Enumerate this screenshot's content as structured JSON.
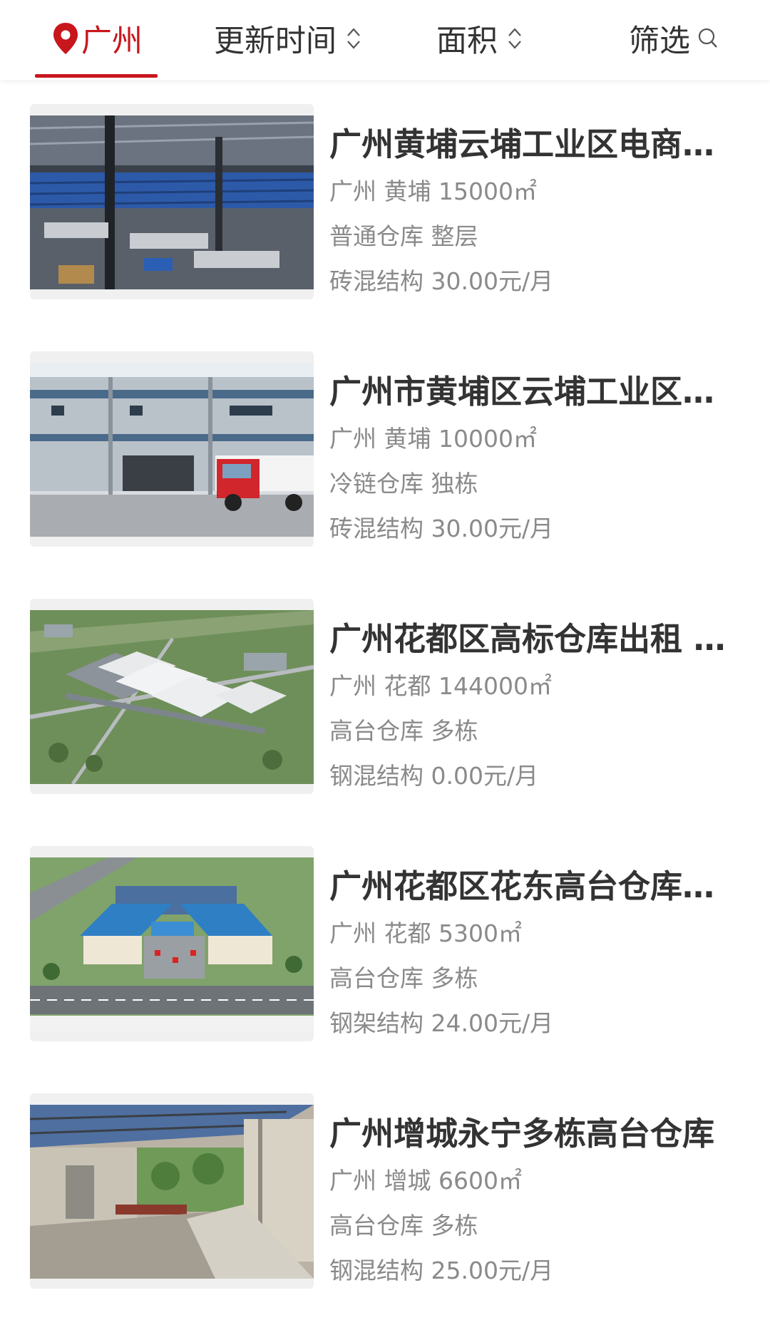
{
  "filter_bar": {
    "city": "广州",
    "update_time": "更新时间",
    "area": "面积",
    "filter": "筛选"
  },
  "listings": [
    {
      "title": "广州黄埔云埔工业区电商仓库",
      "location": "广州 黄埔 15000㎡",
      "type": "普通仓库 整层",
      "price": "砖混结构 30.00元/月",
      "image": "warehouse-interior-photo"
    },
    {
      "title": "广州市黄埔区云埔工业区冷链仓库",
      "location": "广州 黄埔 10000㎡",
      "type": "冷链仓库 独栋",
      "price": "砖混结构 30.00元/月",
      "image": "cold-chain-warehouse-with-truck-photo"
    },
    {
      "title": "广州花都区高标仓库出租 …",
      "location": "广州 花都 144000㎡",
      "type": "高台仓库 多栋",
      "price": "钢混结构 0.00元/月",
      "image": "logistics-park-aerial-rendering"
    },
    {
      "title": "广州花都区花东高台仓库出租",
      "location": "广州 花都 5300㎡",
      "type": "高台仓库 多栋",
      "price": "钢架结构 24.00元/月",
      "image": "blue-roof-warehouse-rendering"
    },
    {
      "title": "广州增城永宁多栋高台仓库",
      "location": "广州 增城 6600㎡",
      "type": "高台仓库 多栋",
      "price": "钢混结构 25.00元/月",
      "image": "covered-loading-platform-photo"
    }
  ],
  "colors": {
    "accent": "#c8161d",
    "title": "#333333",
    "meta": "#8a8a8a"
  }
}
